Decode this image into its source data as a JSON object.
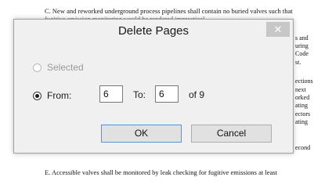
{
  "document": {
    "line_top": "C.   New and reworked underground process pipelines shall contain no buried valves such that",
    "line_top2": "       fugitive emission monitoring would be rendered impractical.",
    "right_fragments": [
      "s and",
      "uring",
      "Code",
      "st.",
      "ections",
      "next",
      "orked",
      "ating",
      "ectors",
      "ating",
      "econd"
    ],
    "line_bottom": "E.   Accessible valves shall be monitored by leak checking for fugitive emissions at least"
  },
  "dialog": {
    "title": "Delete Pages",
    "close_glyph": "✕",
    "selected_label": "Selected",
    "from_label": "From:",
    "from_value": "6",
    "to_label": "To:",
    "to_value": "6",
    "of_label": "of 9",
    "ok_label": "OK",
    "cancel_label": "Cancel"
  }
}
